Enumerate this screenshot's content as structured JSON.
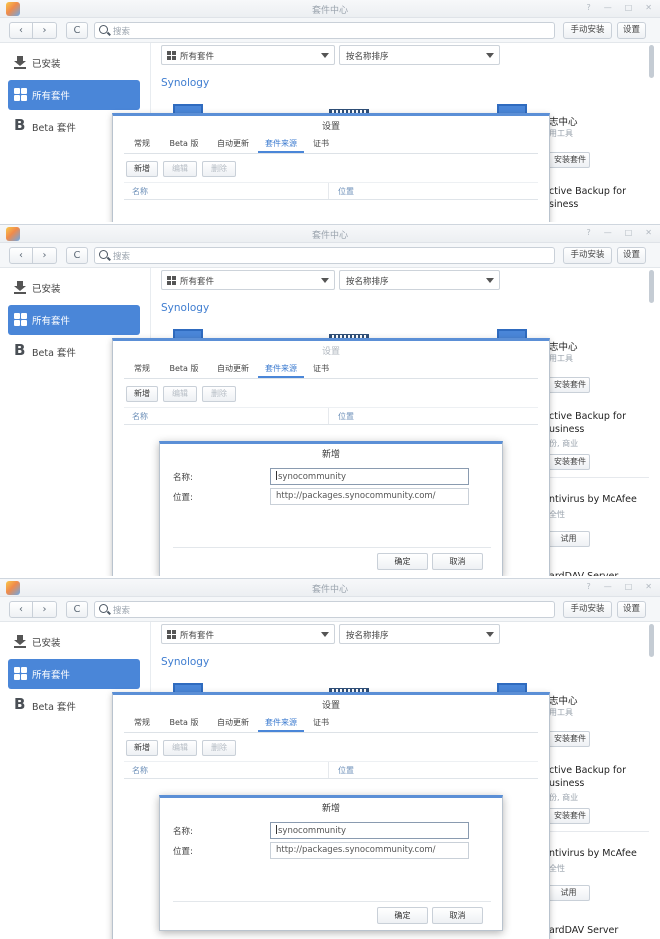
{
  "window": {
    "title": "套件中心",
    "controls": [
      "?",
      "—",
      "□",
      "✕"
    ]
  },
  "toolbar": {
    "back": "‹",
    "forward": "›",
    "refresh": "C",
    "search_placeholder": "搜索",
    "manual_install": "手动安装",
    "settings": "设置"
  },
  "sidebar": {
    "items": [
      {
        "label": "已安装",
        "icon": "download-icon"
      },
      {
        "label": "所有套件",
        "icon": "grid-icon",
        "active": true
      },
      {
        "label": "Beta 套件",
        "icon": "beta-icon"
      }
    ]
  },
  "filters": {
    "category": "所有套件",
    "sort": "按名称排序"
  },
  "section_title": "Synology",
  "right_cards": {
    "card1_title": "志中心",
    "card1_sub": "用工具",
    "card1_sub_alt": "用工具",
    "card1_button": "安装套件",
    "card2_title_a": "ctive Backup for",
    "card2_title_b": "usiness",
    "card2_title_b_alt": "siness",
    "card2_sub": "份, 商业",
    "card2_button": "安装套件",
    "card3_title": "ntivirus by McAfee",
    "card3_sub": "全性",
    "card3_button": "试用",
    "card4_title": "ardDAV Server"
  },
  "settings_dialog": {
    "title": "设置",
    "tabs": [
      {
        "label": "常规"
      },
      {
        "label": "Beta 版"
      },
      {
        "label": "自动更新"
      },
      {
        "label": "套件来源",
        "active": true
      },
      {
        "label": "证书"
      }
    ],
    "buttons": {
      "new": "新增",
      "edit": "编辑",
      "delete": "删除"
    },
    "columns": {
      "name": "名称",
      "location": "位置"
    }
  },
  "new_dialog": {
    "title": "新增",
    "name_label": "名称:",
    "name_value": "synocommunity",
    "location_label": "位置:",
    "location_value": "http://packages.synocommunity.com/",
    "ok": "确定",
    "cancel": "取消"
  },
  "colors": {
    "accent": "#4a86d8",
    "link_blue": "#3f7dd0",
    "dialog_top_border": "#5b8fd6"
  }
}
